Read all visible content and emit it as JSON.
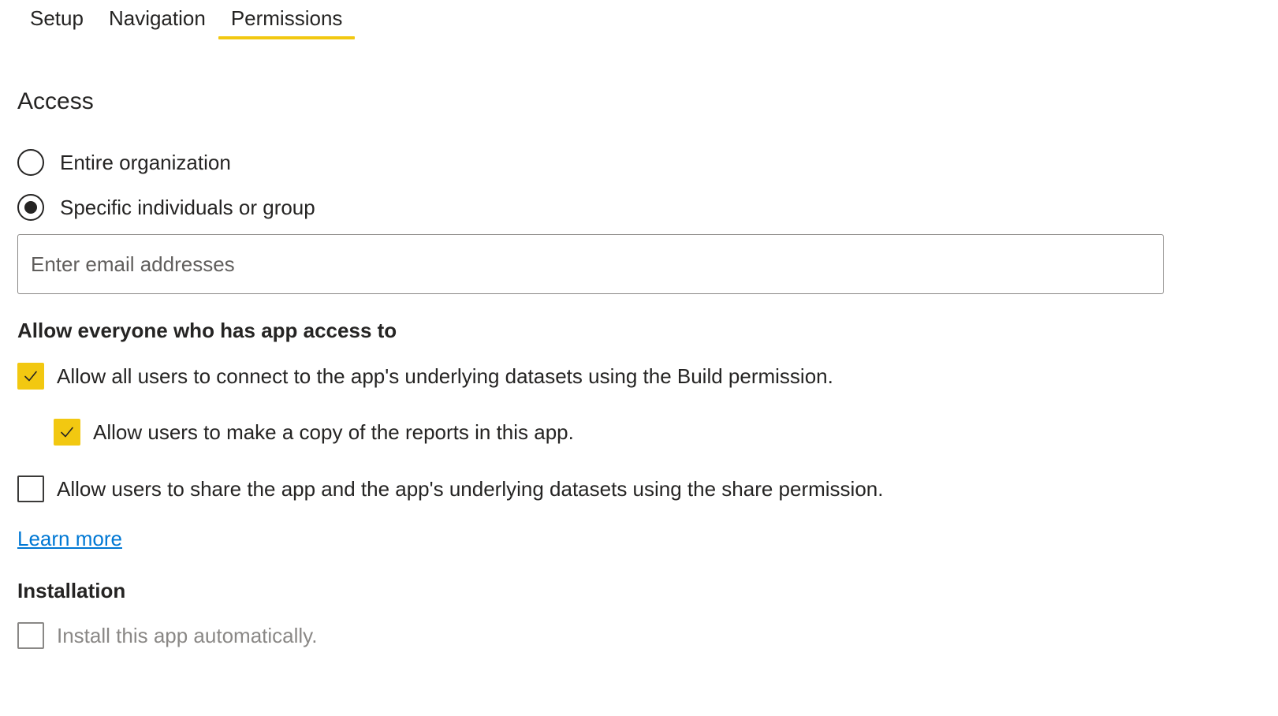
{
  "tabs": [
    {
      "label": "Setup",
      "active": false
    },
    {
      "label": "Navigation",
      "active": false
    },
    {
      "label": "Permissions",
      "active": true
    }
  ],
  "access": {
    "title": "Access",
    "options": [
      {
        "label": "Entire organization",
        "selected": false
      },
      {
        "label": "Specific individuals or group",
        "selected": true
      }
    ],
    "email_placeholder": "Enter email addresses",
    "email_value": ""
  },
  "allow": {
    "title": "Allow everyone who has app access to",
    "build_permission": {
      "label": "Allow all users to connect to the app's underlying datasets using the Build permission.",
      "checked": true
    },
    "copy_reports": {
      "label": "Allow users to make a copy of the reports in this app.",
      "checked": true
    },
    "share_permission": {
      "label": "Allow users to share the app and the app's underlying datasets using the share permission.",
      "checked": false
    }
  },
  "learn_more": "Learn more",
  "installation": {
    "title": "Installation",
    "auto_install": {
      "label": "Install this app automatically.",
      "checked": false,
      "disabled": true
    }
  },
  "colors": {
    "accent": "#f2c811",
    "link": "#0078d4",
    "text": "#252423",
    "disabled_text": "#8a8886"
  },
  "icons": {
    "checkmark": "checkmark-icon"
  }
}
